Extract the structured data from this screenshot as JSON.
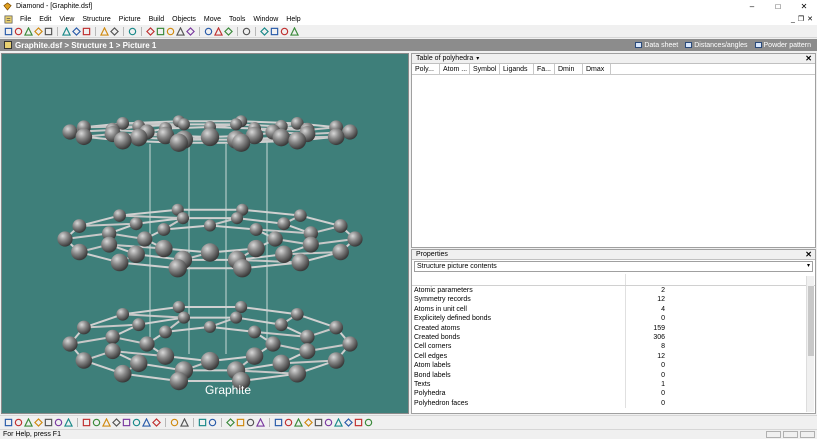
{
  "window": {
    "title": "Diamond - [Graphite.dsf]"
  },
  "window_controls": {
    "minimize": "–",
    "maximize": "□",
    "close": "✕"
  },
  "mdi_controls": {
    "minimize": "_",
    "restore": "❐",
    "close": "✕"
  },
  "menu": [
    "File",
    "Edit",
    "View",
    "Structure",
    "Picture",
    "Build",
    "Objects",
    "Move",
    "Tools",
    "Window",
    "Help"
  ],
  "toolbar": {
    "icons": [
      "new-icon",
      "open-icon",
      "save-icon",
      "print-preview-icon",
      "print-icon",
      "sep",
      "cut-icon",
      "copy-icon",
      "paste-icon",
      "sep",
      "undo-icon",
      "redo-icon",
      "sep",
      "help-icon",
      "sep",
      "render-icon",
      "structure-icon",
      "lasso-icon",
      "wizard-icon",
      "table-icon",
      "sep",
      "delete-atoms-icon",
      "delete-bonds-icon",
      "delete-misc-icon",
      "sep",
      "remove-icon",
      "sep",
      "zoom-icon",
      "rotate-icon",
      "pan-icon",
      "fit-icon"
    ]
  },
  "document": {
    "path": "Graphite.dsf > Structure 1 > Picture 1",
    "tabs": [
      "Data sheet",
      "Distances/angles",
      "Powder pattern"
    ]
  },
  "viewport": {
    "background": "#3e7f7a",
    "caption": "Graphite"
  },
  "polyhedra_panel": {
    "title": "Table of polyhedra",
    "columns": [
      "Poly...",
      "Atom ...",
      "Symbol",
      "Ligands",
      "Fa...",
      "Dmin",
      "Dmax"
    ]
  },
  "properties_panel": {
    "title": "Properties",
    "selector": "Structure picture contents",
    "rows": [
      {
        "name": "Atomic parameters",
        "value": "2"
      },
      {
        "name": "Symmetry records",
        "value": "12"
      },
      {
        "name": "Atoms in unit cell",
        "value": "4"
      },
      {
        "name": "Explicitely defined bonds",
        "value": "0"
      },
      {
        "name": "Created atoms",
        "value": "159"
      },
      {
        "name": "Created bonds",
        "value": "306"
      },
      {
        "name": "Cell corners",
        "value": "8"
      },
      {
        "name": "Cell edges",
        "value": "12"
      },
      {
        "name": "Atom labels",
        "value": "0"
      },
      {
        "name": "Bond labels",
        "value": "0"
      },
      {
        "name": "Texts",
        "value": "1"
      },
      {
        "name": "Polyhedra",
        "value": "0"
      },
      {
        "name": "Polyhedron faces",
        "value": "0"
      }
    ]
  },
  "bottom_toolbar": {
    "icons": [
      "select-icon",
      "atoms-icon",
      "bonds-icon",
      "polyhedra-icon",
      "cell-icon",
      "grid-icon",
      "labels-icon",
      "sep",
      "color-icon",
      "ellipse-icon",
      "moon-icon",
      "image-icon",
      "box-icon",
      "diamond-icon",
      "crystal-icon",
      "arrow-dropdown-icon",
      "sep",
      "view-icon",
      "render-mode-icon",
      "sep",
      "model-icon",
      "layout-icon",
      "sep",
      "axis-icon",
      "triangle-icon",
      "measure-icon",
      "measure2-icon",
      "sep",
      "pointer-icon",
      "move-icon",
      "rotate-x-icon",
      "crosshair-icon",
      "zoom-fit-icon",
      "arrow-icon",
      "scale-icon",
      "spin-icon",
      "copy-view-icon",
      "paste-view-icon"
    ]
  },
  "status": {
    "text": "For Help, press F1"
  }
}
